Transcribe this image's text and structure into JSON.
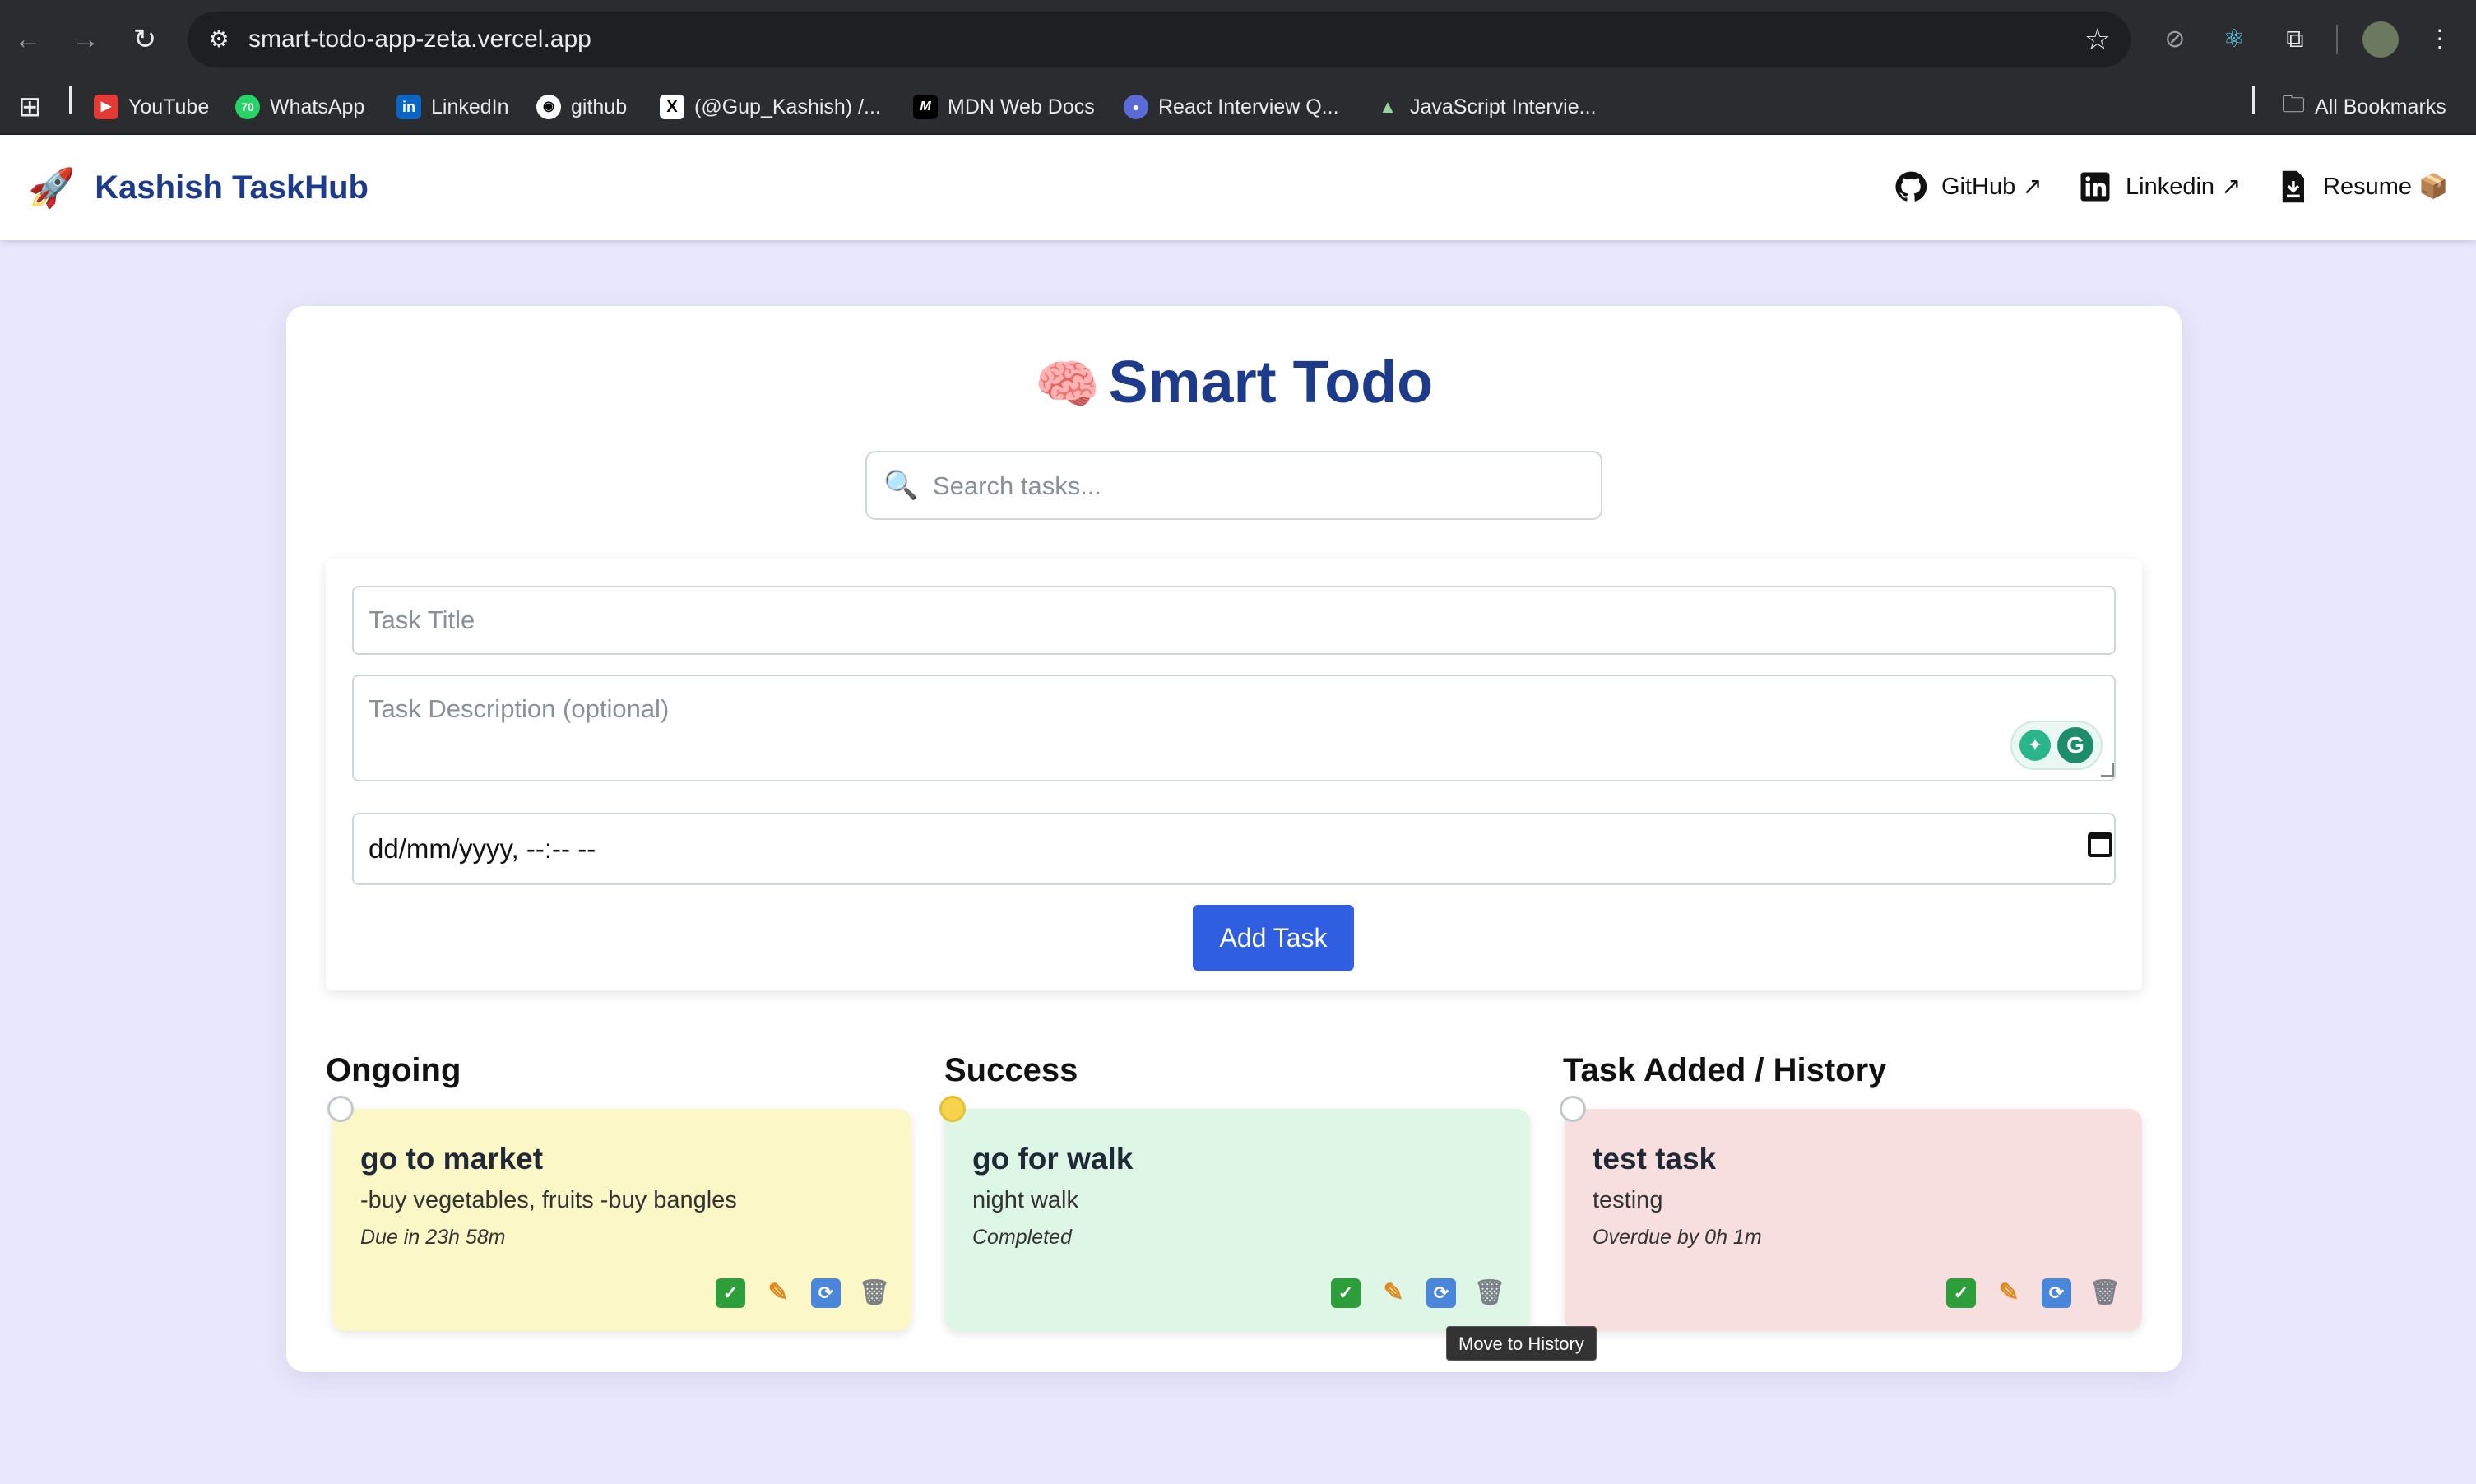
{
  "browser": {
    "url": "smart-todo-app-zeta.vercel.app",
    "bookmarks": [
      {
        "label": "YouTube",
        "icon": "youtube-icon",
        "color": "#e53935"
      },
      {
        "label": "WhatsApp",
        "icon": "whatsapp-icon",
        "color": "#25d366"
      },
      {
        "label": "LinkedIn",
        "icon": "linkedin-icon",
        "color": "#0a66c2"
      },
      {
        "label": "github",
        "icon": "github-icon",
        "color": "#ffffff"
      },
      {
        "label": "(@Gup_Kashish) /...",
        "icon": "x-icon",
        "color": "#000000"
      },
      {
        "label": "MDN Web Docs",
        "icon": "mdn-icon",
        "color": "#000000"
      },
      {
        "label": "React Interview Q...",
        "icon": "globe-icon",
        "color": "#5b6bd6"
      },
      {
        "label": "JavaScript Intervie...",
        "icon": "mountain-icon",
        "color": "#9ad1a0"
      }
    ],
    "all_bookmarks": "All Bookmarks"
  },
  "app": {
    "brand": "Kashish TaskHub",
    "links": [
      {
        "label": "GitHub ↗",
        "icon": "github-icon"
      },
      {
        "label": "Linkedin ↗",
        "icon": "linkedin-icon"
      },
      {
        "label": "Resume 📦",
        "icon": "download-file-icon"
      }
    ]
  },
  "todo": {
    "title": "Smart Todo",
    "search_placeholder": "Search tasks...",
    "title_placeholder": "Task Title",
    "desc_placeholder": "Task Description (optional)",
    "date_value": "dd/mm/yyyy, --:-- --",
    "add_button": "Add Task",
    "columns": [
      {
        "heading": "Ongoing",
        "task": {
          "title": "go to market",
          "description": "-buy vegetables, fruits -buy bangles",
          "status": "Due in 23h 58m"
        }
      },
      {
        "heading": "Success",
        "task": {
          "title": "go for walk",
          "description": "night walk",
          "status": "Completed"
        }
      },
      {
        "heading": "Task Added / History",
        "task": {
          "title": "test task",
          "description": "testing",
          "status": "Overdue by 0h 1m"
        }
      }
    ],
    "tooltip": "Move to History"
  },
  "colors": {
    "accent": "#2f5fe0",
    "brand": "#1e3a8a",
    "ongoing": "#fcf7c6",
    "success": "#def6e6",
    "history": "#f7dfdf"
  }
}
